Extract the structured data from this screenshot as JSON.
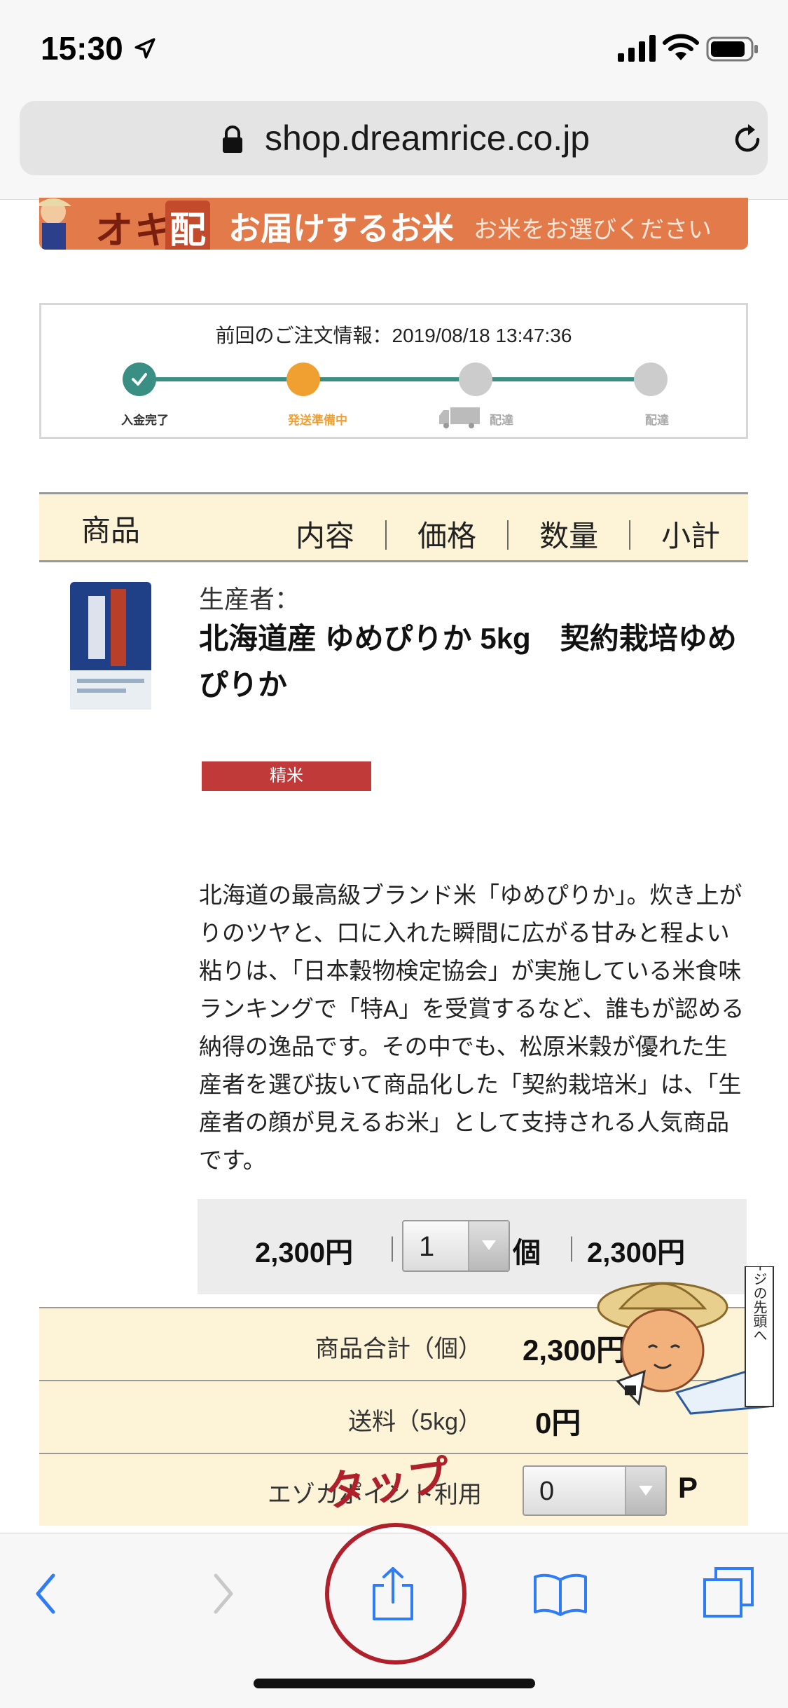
{
  "status_bar": {
    "time": "15:30"
  },
  "browser": {
    "url": "shop.dreamrice.co.jp"
  },
  "banner": {
    "logo": "オキ",
    "logo_badge": "配",
    "title": "お届けするお米",
    "subtitle": "お米をお選びください"
  },
  "order_status": {
    "info": "前回のご注文情報：2019/08/18 13:47:36",
    "steps": [
      {
        "label": "入金完了",
        "state": "done"
      },
      {
        "label": "発送準備中",
        "state": "current"
      },
      {
        "label": "配達",
        "state": "pending"
      },
      {
        "label": "配達",
        "state": "pending"
      }
    ]
  },
  "table_header": {
    "product": "商品",
    "content": "内容",
    "price": "価格",
    "quantity": "数量",
    "subtotal": "小計",
    "separator": "｜"
  },
  "product": {
    "producer_label": "生産者：",
    "name": "北海道産 ゆめぴりか 5kg　契約栽培ゆめぴりか",
    "tag": "精米",
    "description": "北海道の最高級ブランド米「ゆめぴりか」。炊き上がりのツヤと、口に入れた瞬間に広がる甘みと程よい粘りは、「日本穀物検定協会」が実施している米食味ランキングで「特A」を受賞するなど、誰もが認める納得の逸品です。その中でも、松原米穀が優れた生産者を選び抜いて商品化した「契約栽培米」は、「生産者の顔が見えるお米」として支持される人気商品です。",
    "price": "2,300円",
    "quantity": "1",
    "unit": "個",
    "subtotal": "2,300円"
  },
  "summary": {
    "total_label": "商品合計（個）",
    "total_value": "2,300円",
    "shipping_label": "送料（5kg）",
    "shipping_value": "0円",
    "points_label": "エゾカポイント利用",
    "points_value": "0",
    "points_unit": "P"
  },
  "annotation": {
    "tap_label": "タップ"
  },
  "mascot": {
    "caption": "このページの先頭へ"
  },
  "colors": {
    "accent_orange": "#e37a4a",
    "progress_teal": "#3a8f84",
    "progress_current": "#f0a030",
    "table_header_bg": "#fdf3d6",
    "tag_red": "#c03a3a",
    "ios_blue": "#2f7cf6",
    "tap_red": "#b0202a"
  }
}
